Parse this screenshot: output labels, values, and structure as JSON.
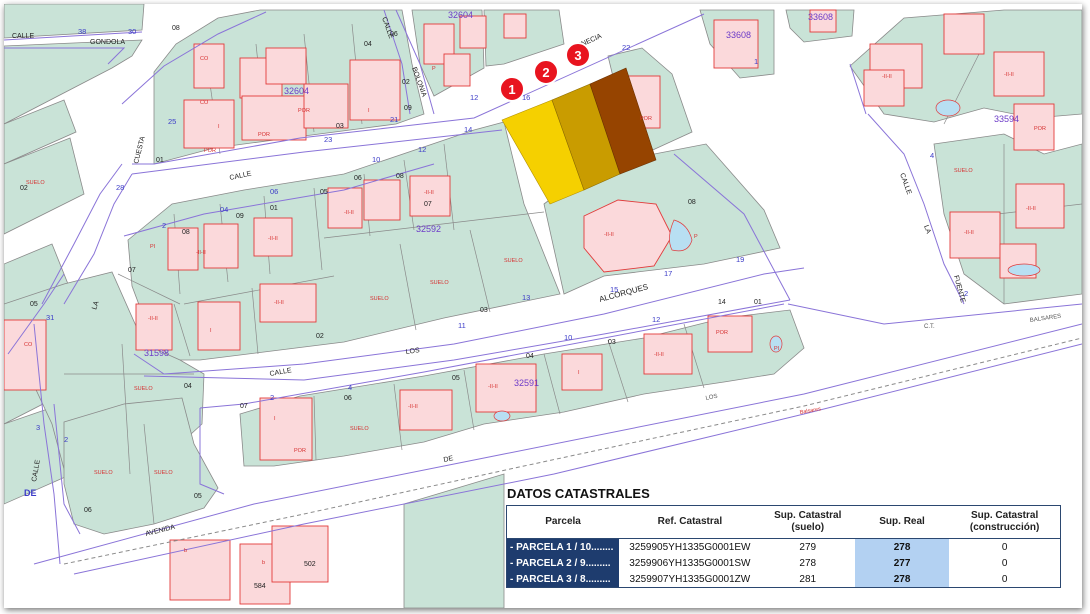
{
  "map": {
    "streets": {
      "calle_gondola": "CALLE",
      "gondola": "GONDOLA",
      "calle_bolonia": "CALLE",
      "bolonia": "BOLONIA",
      "venecia": "VENECIA",
      "cuesta": "CUESTA",
      "calle_mid": "CALLE",
      "calle_left": "CALLE",
      "la_left": "LA",
      "de_left": "DE",
      "alcorques": "ALCORQUES",
      "los": "LOS",
      "calle_los": "CALLE",
      "calle_la": "CALLE",
      "la_right": "LA",
      "fuente": "FUENTE",
      "avenida": "AVENIDA",
      "de_bottom": "DE",
      "los_small": "LOS",
      "balsares": "BALSARES",
      "balsares_small": "Balsares",
      "ct": "C.T."
    },
    "manzanas": {
      "m32604_top": "32604",
      "m32604": "32604",
      "m33608_top": "33608",
      "m33608": "33608",
      "m33594": "33594",
      "m32592": "32592",
      "m31598": "31598",
      "m32591": "32591"
    },
    "numbers": {
      "n08": "08",
      "n38": "38",
      "n30": "30",
      "n04": "04",
      "n06": "06",
      "n02": "02",
      "n09": "09",
      "n12": "12",
      "n16": "16",
      "n21": "21",
      "n23": "23",
      "n03": "03",
      "n25": "25",
      "n01": "01",
      "n28": "28",
      "n22": "22",
      "n14": "14",
      "n10": "10",
      "n05": "05",
      "n07": "07",
      "n11": "11",
      "n13": "13",
      "n15": "15",
      "n17": "17",
      "n19": "19",
      "n31": "31",
      "n502": "502",
      "n584": "584",
      "n1": "1",
      "n2": "2",
      "n3": "3",
      "n4": "4"
    },
    "labels": {
      "suelo": "SUELO",
      "por": "POR",
      "co": "CO",
      "p": "P",
      "i": "I",
      "b": "b",
      "i2": "-II-II",
      "pi": "PI"
    },
    "markers": [
      "1",
      "2",
      "3"
    ],
    "colors": {
      "parcel": "#c9e3d7",
      "parcel_line": "#8a8a8a",
      "building": "#fbd9db",
      "building_line": "#e23a3a",
      "street_line": "#8a74d8",
      "plot1": "#f5d000",
      "plot2": "#c99c00",
      "plot3": "#964400",
      "marker": "#e8141f"
    }
  },
  "table": {
    "title": "DATOS CATASTRALES",
    "headers": {
      "parcela": "Parcela",
      "ref": "Ref. Catastral",
      "sup_catastral_1": "Sup. Catastral",
      "sup_catastral_2": "(suelo)",
      "sup_real": "Sup. Real",
      "sup_const_1": "Sup. Catastral",
      "sup_const_2": "(construcción)"
    },
    "rows": [
      {
        "parcela": "- PARCELA 1 / 10........",
        "ref": "3259905YH1335G0001EW",
        "suelo": "279",
        "real": "278",
        "construccion": "0"
      },
      {
        "parcela": "- PARCELA 2 / 9.........",
        "ref": "3259906YH1335G0001SW",
        "suelo": "278",
        "real": "277",
        "construccion": "0"
      },
      {
        "parcela": "- PARCELA 3 / 8.........",
        "ref": "3259907YH1335G0001ZW",
        "suelo": "281",
        "real": "278",
        "construccion": "0"
      }
    ]
  }
}
